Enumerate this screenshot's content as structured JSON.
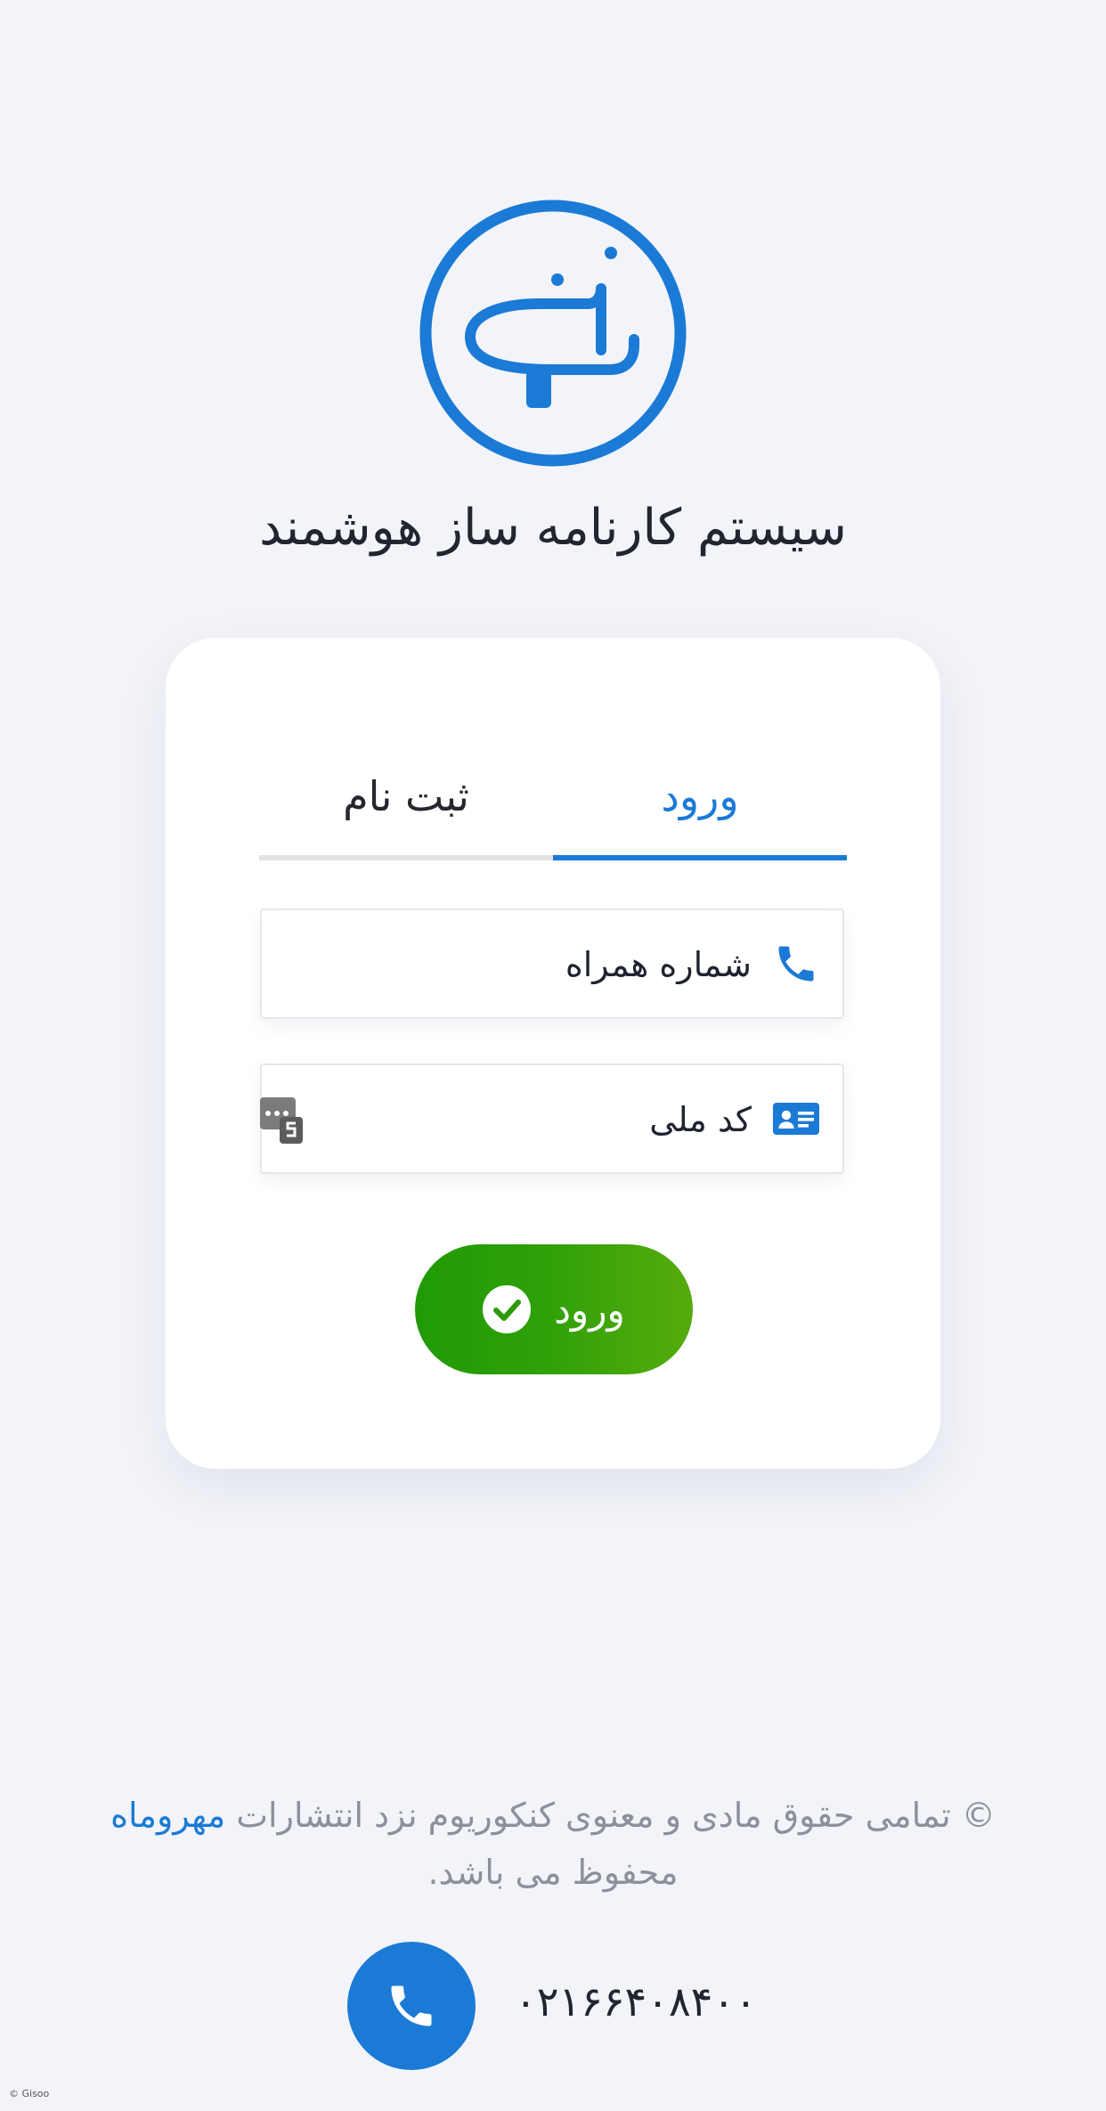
{
  "app": {
    "title": "سیستم کارنامه ساز هوشمند"
  },
  "tabs": [
    {
      "label": "ورود",
      "active": true
    },
    {
      "label": "ثبت نام",
      "active": false
    }
  ],
  "form": {
    "phone": {
      "placeholder": "شماره همراه",
      "value": "",
      "icon": "phone-icon"
    },
    "national_code": {
      "placeholder": "کد ملی",
      "value": "",
      "icon": "id-card-icon"
    },
    "submit_label": "ورود"
  },
  "footer": {
    "copyright_prefix": "© تمامی حقوق مادی و معنوی کنکوریوم نزد انتشارات",
    "brand": "مهروماه",
    "copyright_suffix": "محفوظ می باشد.",
    "phone_number": "۰۲۱۶۶۴۰۸۴۰۰",
    "credit": "© Gisoo"
  },
  "colors": {
    "accent": "#1b7ad6",
    "success_start": "#1f9a06",
    "success_end": "#56ab0d",
    "background": "#f2f4f9"
  }
}
